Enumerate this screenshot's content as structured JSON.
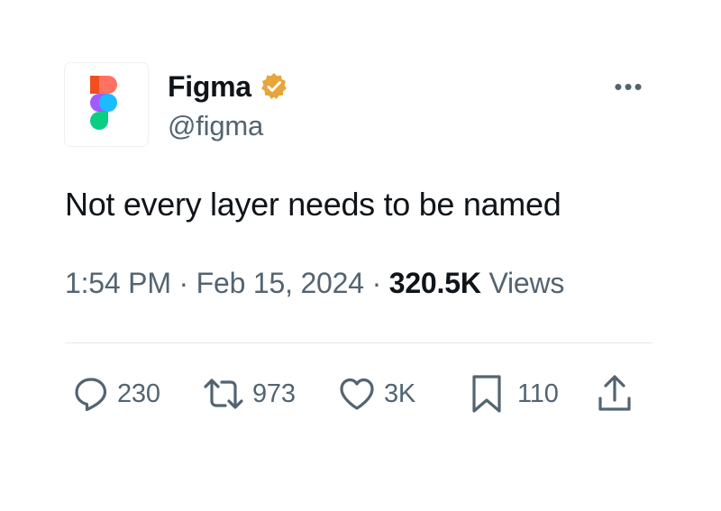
{
  "author": {
    "display_name": "Figma",
    "handle": "@figma",
    "verified": true,
    "verified_badge_color": "#e8a53a",
    "avatar_icon": "figma-logo-icon"
  },
  "tweet": {
    "text": "Not every layer needs to be named",
    "time": "1:54 PM",
    "date": "Feb 15, 2024",
    "separator": "·",
    "views_count": "320.5K",
    "views_label": "Views"
  },
  "actions": {
    "replies": "230",
    "retweets": "973",
    "likes": "3K",
    "bookmarks": "110"
  },
  "menu": {
    "more_label": "•••"
  },
  "colors": {
    "text_primary": "#0f1419",
    "text_secondary": "#536471",
    "divider": "#e6e9ec",
    "figma_red": "#f24e1e",
    "figma_orange": "#ff7262",
    "figma_purple": "#a259ff",
    "figma_blue": "#1abcfe",
    "figma_green": "#0acf83"
  }
}
